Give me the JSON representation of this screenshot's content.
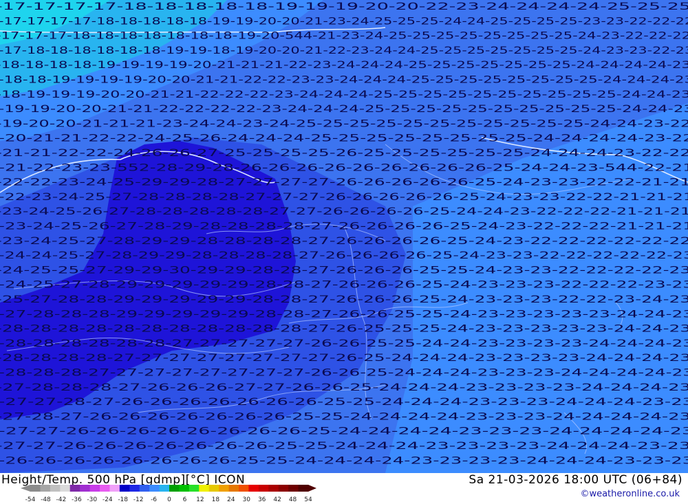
{
  "footer": {
    "title_left": "Height/Temp. 500 hPa [gdmp][°C] ICON",
    "title_right": "Sa 21-03-2026 18:00 UTC (06+84)",
    "credit": "©weatheronline.co.uk"
  },
  "legend": {
    "ticks": [
      "-54",
      "-48",
      "-42",
      "-36",
      "-30",
      "-24",
      "-18",
      "-12",
      "-6",
      "0",
      "6",
      "12",
      "18",
      "24",
      "30",
      "36",
      "42",
      "48",
      "54"
    ],
    "colors": [
      "#8c8c8c",
      "#a6a6a6",
      "#c0c0c0",
      "#dadada",
      "#7f2aa8",
      "#a02fd0",
      "#c83de8",
      "#e85cf0",
      "#f0a0f8",
      "#0000c8",
      "#1e28e6",
      "#3260f0",
      "#3c8cff",
      "#28b4f0",
      "#00a000",
      "#00c000",
      "#28e028",
      "#f0f000",
      "#e6c800",
      "#f0a000",
      "#e67800",
      "#f05000",
      "#e60000",
      "#c80000",
      "#aa0000",
      "#8c0000",
      "#6e0000",
      "#500000"
    ]
  },
  "contours": {
    "height_labels": [
      {
        "label": "544",
        "pos": "top-center"
      },
      {
        "label": "552",
        "pos": "west"
      },
      {
        "label": "544",
        "pos": "east"
      }
    ]
  },
  "temperature_rows": [
    "-17-17-17-17-18-18-18-18-18-19-19-19-20-20-22-23-24-24-24-24-25-25-25",
    "-17-17-17-17-18-18-18-18-18-19-19-20-20-21-23-24-25-25-25-24-24-25-25-25-25-23-23-22-22-22",
    "-17-17-17-18-18-18-18-18-18-18-19-20-544-21-23-24-25-25-25-25-25-25-25-25-24-23-22-22-22",
    "-17-18-18-18-18-18-18-19-19-18-19-20-20-21-22-23-24-24-25-25-25-25-25-25-25-24-23-23-22-23",
    "-18-18-18-18-19-19-19-19-20-21-21-21-22-23-24-24-24-25-25-25-25-25-25-25-24-24-24-24-23",
    "-18-18-19-19-19-19-20-20-21-21-22-22-23-23-24-24-24-25-25-25-25-25-25-25-25-24-24-24-23",
    "-18-19-19-19-20-20-21-21-22-22-22-23-24-24-24-25-25-25-25-25-25-25-25-25-25-24-24-23",
    "-19-19-20-20-21-21-22-22-22-22-23-24-24-24-25-25-25-25-25-25-25-25-25-25-24-24-23",
    "-19-20-20-21-21-21-23-24-24-23-24-25-25-25-25-25-25-25-25-25-25-25-24-24-23-22",
    "-20-21-21-22-22-24-25-26-24-24-24-25-25-25-25-25-25-25-25-24-24-24-24-23-22",
    "-21-21-22-22-24-26-26-27-25-25-25-25-26-25-25-25-25-25-25-24-24-24-23-22-22",
    "-21-22-23-23-552-28-29-28-26-26-26-26-26-26-26-26-26-25-24-24-23-544-22-21",
    "-22-22-23-24-25-29-29-28-27-27-27-27-26-26-26-26-26-25-24-23-23-22-22-21-21",
    "-22-23-24-25-27-28-28-28-28-27-27-27-26-26-26-26-26-25-24-23-23-22-22-21-21-21",
    "-23-24-25-26-27-28-28-28-28-28-27-27-26-26-26-26-25-24-24-23-22-22-22-21-21-21",
    "-23-24-25-26-27-28-29-28-28-28-28-27-26-26-26-26-25-24-23-22-22-22-21-21-21",
    "-23-24-25-27-28-29-29-28-28-28-28-27-26-26-26-26-25-24-23-22-22-22-22-22-22",
    "-24-24-25-27-28-29-29-28-28-28-28-27-26-26-26-26-25-24-23-23-22-22-22-22-22-23",
    "-24-25-25-27-29-29-30-29-29-28-28-27-26-26-26-25-25-24-23-23-22-22-22-22-23",
    "-24-25-27-28-29-29-29-29-29-28-28-27-26-26-26-25-24-23-23-23-22-22-22-23-23",
    "-25-27-28-28-29-29-29-29-29-28-28-27-26-26-26-25-24-23-23-23-22-22-23-24-23",
    "-27-28-28-28-29-29-29-29-29-28-28-27-26-26-25-25-24-23-23-23-23-23-24-24-23",
    "-28-28-28-28-28-28-28-28-28-28-28-27-26-25-25-25-24-23-23-23-23-23-24-24-23",
    "-28-28-28-28-28-28-27-27-27-27-27-26-26-25-25-24-24-23-23-23-23-24-24-24-23",
    "-28-28-28-28-27-27-27-27-27-27-27-27-26-25-24-24-24-23-23-23-23-24-24-24-23",
    "-28-28-28-27-27-27-27-27-27-27-27-26-26-25-24-24-24-23-23-23-24-24-24-24-23",
    "-27-28-28-28-27-26-26-26-27-27-26-26-25-24-24-24-23-23-23-23-24-24-24-23",
    "-27-27-28-27-26-26-26-26-26-26-26-25-25-24-24-24-23-23-23-24-24-24-23-23",
    "-27-28-27-26-26-26-26-26-26-26-25-25-24-24-24-24-23-23-23-24-24-24-24-23",
    "-27-27-26-26-26-26-26-26-26-26-25-24-24-24-24-23-23-23-24-24-24-24-23",
    "-27-27-26-26-26-26-26-26-26-25-25-24-24-24-23-23-23-23-24-24-24-23-23",
    "-26-26-26-26-26-26-26-26-25-25-24-24-24-24-23-23-23-23-24-24-24-23-23-23"
  ]
}
